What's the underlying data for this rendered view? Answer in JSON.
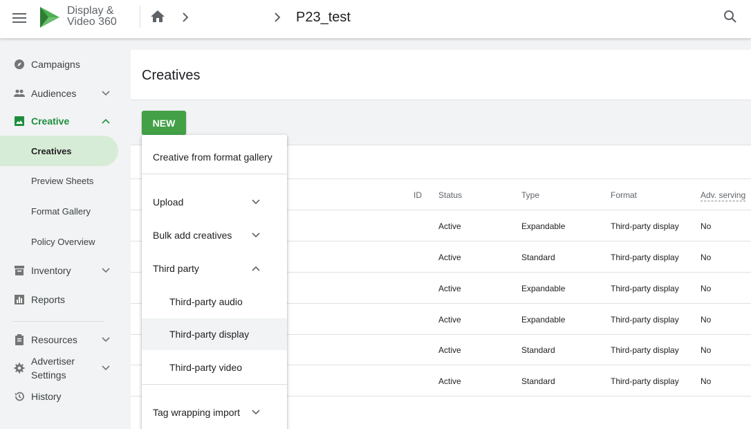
{
  "header": {
    "brand_line1": "Display &",
    "brand_line2": "Video 360",
    "page_title": "P23_test"
  },
  "sidebar": {
    "items": [
      {
        "label": "Campaigns",
        "icon": "compass-icon"
      },
      {
        "label": "Audiences",
        "icon": "people-icon"
      },
      {
        "label": "Creative",
        "icon": "image-icon"
      },
      {
        "label": "Inventory",
        "icon": "inventory-icon"
      },
      {
        "label": "Reports",
        "icon": "bar-chart-icon"
      },
      {
        "label": "Resources",
        "icon": "clipboard-icon"
      },
      {
        "label": "Advertiser",
        "label2": "Settings",
        "icon": "gear-icon"
      },
      {
        "label": "History",
        "icon": "history-icon"
      }
    ],
    "creative_subitems": [
      "Creatives",
      "Preview Sheets",
      "Format Gallery",
      "Policy Overview"
    ]
  },
  "main": {
    "title": "Creatives",
    "new_button": "NEW"
  },
  "table": {
    "columns": [
      "ID",
      "Status",
      "Type",
      "Format",
      "Adv. serving"
    ],
    "rows": [
      {
        "status": "Active",
        "type": "Expandable",
        "format": "Third-party display",
        "adv_serving": "No"
      },
      {
        "status": "Active",
        "type": "Standard",
        "format": "Third-party display",
        "adv_serving": "No"
      },
      {
        "status": "Active",
        "type": "Expandable",
        "format": "Third-party display",
        "adv_serving": "No"
      },
      {
        "status": "Active",
        "type": "Expandable",
        "format": "Third-party display",
        "adv_serving": "No"
      },
      {
        "status": "Active",
        "type": "Standard",
        "format": "Third-party display",
        "adv_serving": "No"
      },
      {
        "status": "Active",
        "type": "Standard",
        "format": "Third-party display",
        "adv_serving": "No"
      }
    ]
  },
  "new_menu": {
    "items": [
      "Creative from format gallery",
      "Upload",
      "Bulk add creatives",
      "Third party",
      "Third-party audio",
      "Third-party display",
      "Third-party video",
      "Tag wrapping import"
    ]
  },
  "colors": {
    "accent_green": "#1e8e3e",
    "new_button": "#43a047",
    "selected_nav_bg": "#d7ecd6"
  }
}
